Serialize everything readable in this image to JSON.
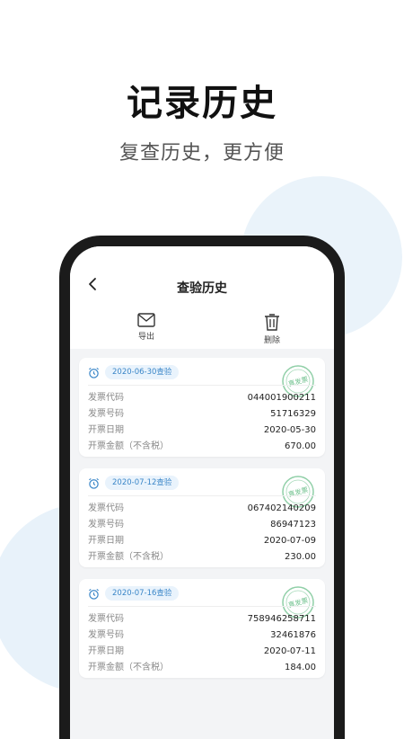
{
  "promo": {
    "title": "记录历史",
    "subtitle": "复查历史，更方便"
  },
  "app": {
    "title": "查验历史",
    "toolbar": {
      "export_label": "导出",
      "delete_label": "删除"
    },
    "stamp_text": "真发票",
    "records": [
      {
        "check_date": "2020-06-30查验",
        "fields": [
          {
            "label": "发票代码",
            "value": "044001900211"
          },
          {
            "label": "发票号码",
            "value": "51716329"
          },
          {
            "label": "开票日期",
            "value": "2020-05-30"
          },
          {
            "label": "开票金额（不含税）",
            "value": "670.00"
          }
        ]
      },
      {
        "check_date": "2020-07-12查验",
        "fields": [
          {
            "label": "发票代码",
            "value": "067402140209"
          },
          {
            "label": "发票号码",
            "value": "86947123"
          },
          {
            "label": "开票日期",
            "value": "2020-07-09"
          },
          {
            "label": "开票金额（不含税）",
            "value": "230.00"
          }
        ]
      },
      {
        "check_date": "2020-07-16查验",
        "fields": [
          {
            "label": "发票代码",
            "value": "758946258711"
          },
          {
            "label": "发票号码",
            "value": "32461876"
          },
          {
            "label": "开票日期",
            "value": "2020-07-11"
          },
          {
            "label": "开票金额（不含税）",
            "value": "184.00"
          }
        ]
      }
    ]
  },
  "colors": {
    "accent": "#3a86c8",
    "stamp": "#6bbf8a",
    "screen_bg": "#f3f4f6"
  }
}
